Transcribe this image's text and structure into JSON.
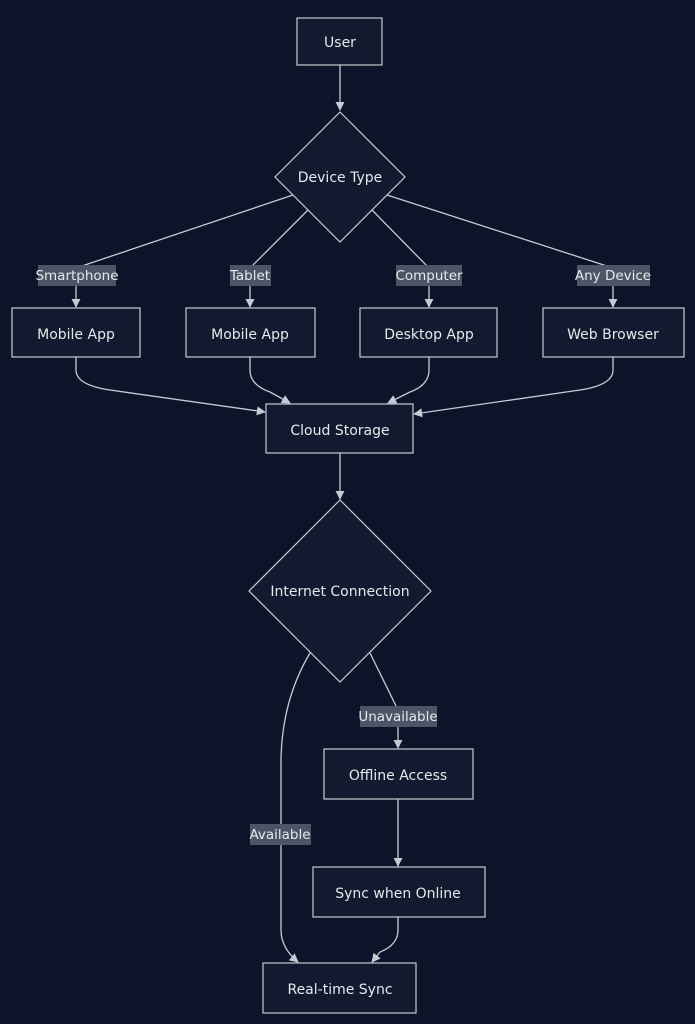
{
  "nodes": {
    "user": "User",
    "device_type": "Device Type",
    "mobile_app_1": "Mobile App",
    "mobile_app_2": "Mobile App",
    "desktop_app": "Desktop App",
    "web_browser": "Web Browser",
    "cloud_storage": "Cloud Storage",
    "internet_connection": "Internet Connection",
    "offline_access": "Offline Access",
    "sync_when_online": "Sync when Online",
    "realtime_sync": "Real-time Sync"
  },
  "edge_labels": {
    "smartphone": "Smartphone",
    "tablet": "Tablet",
    "computer": "Computer",
    "any_device": "Any Device",
    "unavailable": "Unavailable",
    "available": "Available"
  },
  "colors": {
    "background": "#0b1429",
    "node_fill": "#111a2e",
    "stroke": "#c5cad3",
    "label_bg": "#4b5566"
  }
}
